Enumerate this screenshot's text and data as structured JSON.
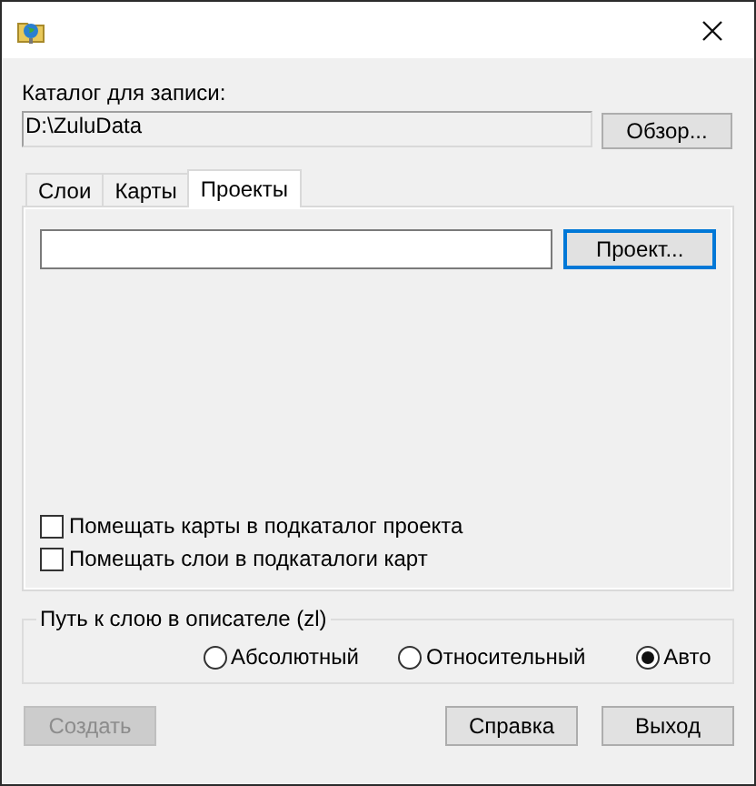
{
  "catalog": {
    "label": "Каталог для записи:",
    "value": "D:\\ZuluData",
    "browse_button": "Обзор..."
  },
  "tabs": [
    {
      "label": "Слои",
      "selected": false
    },
    {
      "label": "Карты",
      "selected": false
    },
    {
      "label": "Проекты",
      "selected": true
    }
  ],
  "project": {
    "button": "Проект..."
  },
  "checkboxes": [
    {
      "label": "Помещать карты в подкаталог проекта",
      "checked": false
    },
    {
      "label": "Помещать слои в подкаталоги карт",
      "checked": false
    }
  ],
  "path_group": {
    "title": "Путь к слою в описателе (zl)",
    "options": [
      {
        "label": "Абсолютный",
        "selected": false
      },
      {
        "label": "Относительный",
        "selected": false
      },
      {
        "label": "Авто",
        "selected": true
      }
    ]
  },
  "buttons": [
    {
      "label": "Создать",
      "disabled": true
    },
    {
      "label": "Справка",
      "disabled": false
    },
    {
      "label": "Выход",
      "disabled": false
    }
  ]
}
